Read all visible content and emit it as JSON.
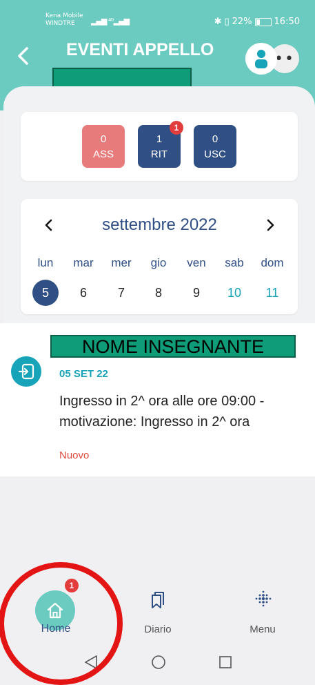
{
  "status_bar": {
    "carrier_1": "Kena Mobile",
    "carrier_2": "WINDTRE",
    "signal": "▂▄▆ ⁴ᴳ▂▄▆",
    "battery": "22%",
    "time": "16:50"
  },
  "header": {
    "title": "EVENTI APPELLO",
    "back_icon": "chevron-left-icon",
    "avatar_icon": "person-icon",
    "more_icon": "dots-icon",
    "color": "#6ccbc0"
  },
  "counters": [
    {
      "value": "0",
      "label": "ASS",
      "color": "#e77b7b"
    },
    {
      "value": "1",
      "label": "RIT",
      "color": "#2f4f85",
      "badge": "1"
    },
    {
      "value": "0",
      "label": "USC",
      "color": "#2f4f85"
    }
  ],
  "calendar": {
    "month": "settembre 2022",
    "weekdays": [
      "lun",
      "mar",
      "mer",
      "gio",
      "ven",
      "sab",
      "dom"
    ],
    "days": [
      "5",
      "6",
      "7",
      "8",
      "9",
      "10",
      "11"
    ],
    "selected_day": "5"
  },
  "event": {
    "teacher": "NOME INSEGNANTE",
    "date": "05 SET 22",
    "text": "Ingresso in 2^ ora alle ore 09:00 - motivazione: Ingresso in 2^ ora",
    "status": "Nuovo",
    "icon": "entry-icon"
  },
  "bottom_nav": {
    "home": {
      "label": "Home",
      "badge": "1",
      "icon": "home-icon"
    },
    "diario": {
      "label": "Diario",
      "icon": "bookmarks-icon"
    },
    "menu": {
      "label": "Menu",
      "icon": "dots-grid-icon"
    }
  },
  "system_nav": {
    "back_icon": "triangle-back-icon",
    "home_icon": "circle-home-icon",
    "recents_icon": "square-recents-icon"
  }
}
